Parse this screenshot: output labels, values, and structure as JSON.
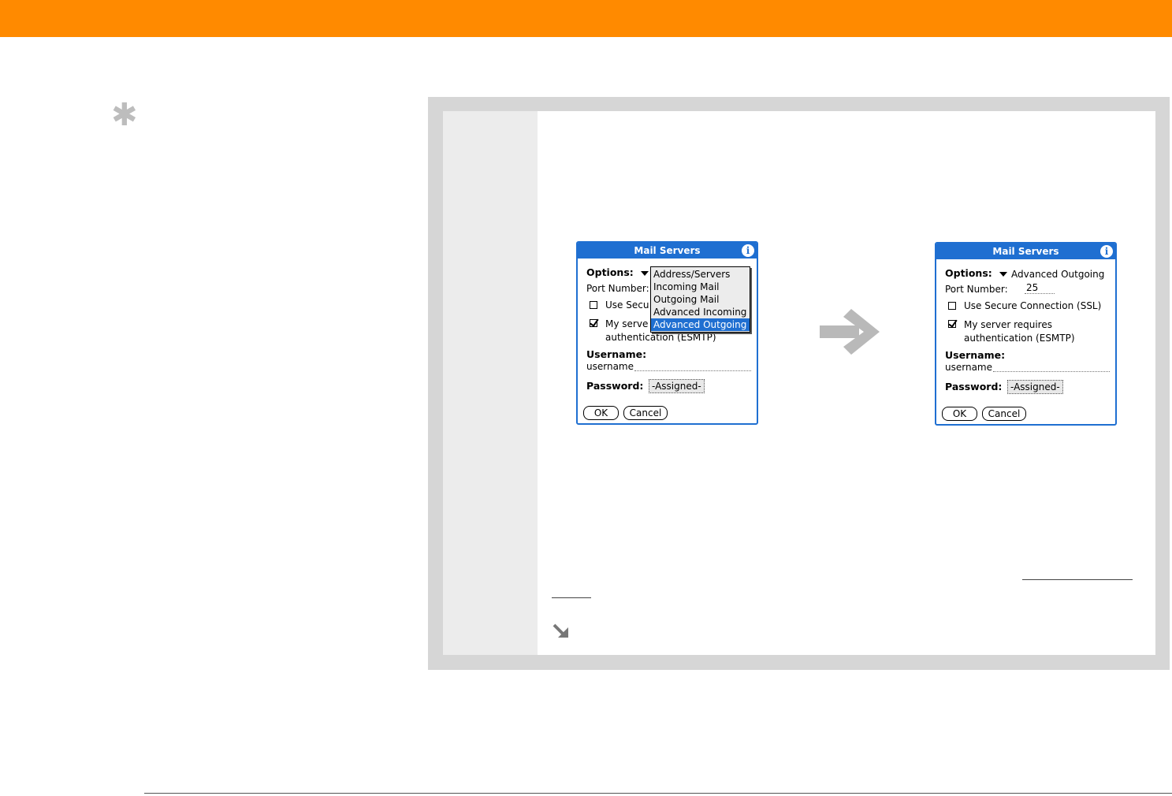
{
  "tip_icon": "asterisk-icon",
  "colors": {
    "accent_orange": "#ff8a00",
    "palm_blue": "#1f6fd1",
    "frame_gray": "#d6d6d6"
  },
  "left_dialog": {
    "title": "Mail Servers",
    "options_label": "Options:",
    "port_label": "Port Number:",
    "ssl_label": "Use Secu",
    "auth_label_line1": "My serve",
    "auth_label_line2": "authentication (ESMTP)",
    "ssl_checked": false,
    "auth_checked": true,
    "username_label": "Username:",
    "username_value": "username",
    "password_label": "Password:",
    "password_value": "-Assigned-",
    "ok_label": "OK",
    "cancel_label": "Cancel",
    "menu_items": [
      "Address/Servers",
      "Incoming Mail",
      "Outgoing Mail",
      "Advanced Incoming",
      "Advanced Outgoing"
    ],
    "menu_selected": "Advanced Outgoing"
  },
  "right_dialog": {
    "title": "Mail Servers",
    "options_label": "Options:",
    "options_value": "Advanced Outgoing",
    "port_label": "Port Number:",
    "port_value": "25",
    "ssl_label": "Use Secure Connection (SSL)",
    "auth_label_line1": "My server requires",
    "auth_label_line2": "authentication (ESMTP)",
    "ssl_checked": false,
    "auth_checked": true,
    "username_label": "Username:",
    "username_value": "username",
    "password_label": "Password:",
    "password_value": "-Assigned-",
    "ok_label": "OK",
    "cancel_label": "Cancel"
  },
  "transition_icon": "right-arrow-icon",
  "continue_icon": "continued-arrow-icon"
}
